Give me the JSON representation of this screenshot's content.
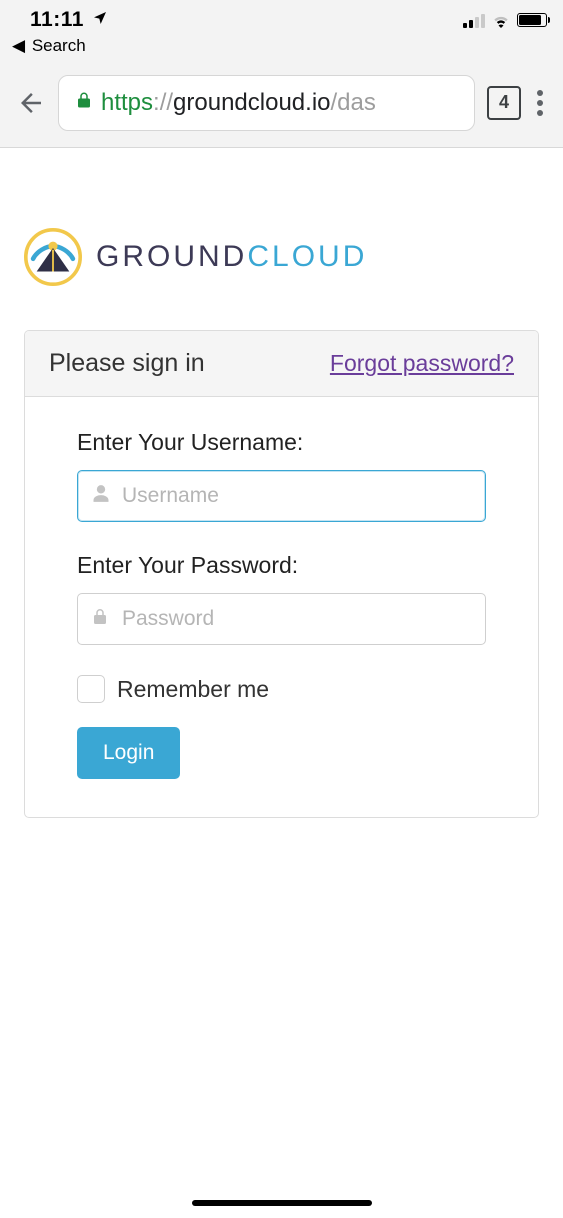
{
  "status": {
    "time": "11:11",
    "back_label": "Search"
  },
  "browser": {
    "url_scheme": "https",
    "url_sep": "://",
    "url_host": "groundcloud.io",
    "url_path": "/das",
    "tab_count": "4"
  },
  "logo": {
    "text_a": "GROUND",
    "text_b": "CLOUD"
  },
  "panel": {
    "title": "Please sign in",
    "forgot_label": "Forgot password?"
  },
  "form": {
    "username_label": "Enter Your Username:",
    "username_placeholder": "Username",
    "username_value": "",
    "password_label": "Enter Your Password:",
    "password_placeholder": "Password",
    "password_value": "",
    "remember_label": "Remember me",
    "login_label": "Login"
  }
}
